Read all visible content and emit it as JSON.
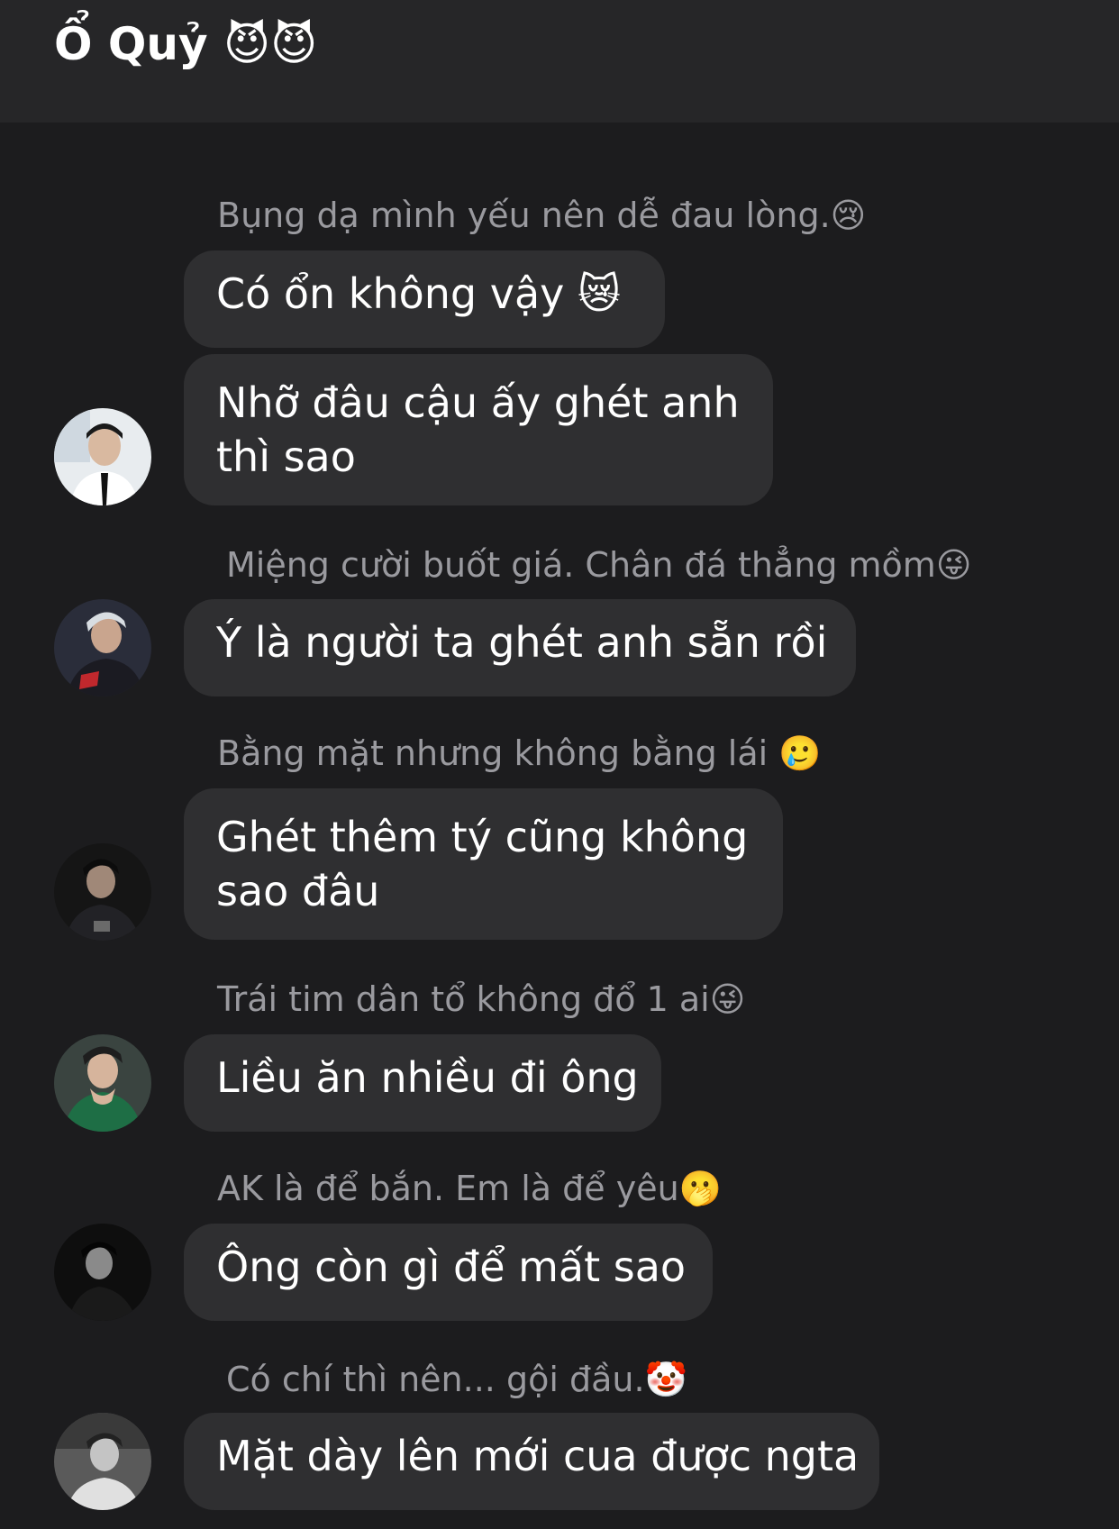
{
  "header": {
    "title": "Ổ Quỷ 😈😈"
  },
  "messages": [
    {
      "nickname": "Bụng dạ mình yếu nên dễ đau lòng.😢",
      "bubbles": [
        "Có ổn không vậy 😿",
        "Nhỡ đâu cậu ấy ghét anh thì sao"
      ],
      "avatar_icon": "avatar-white-shirt-tie"
    },
    {
      "nickname": "Miệng cười buốt giá. Chân đá thẳng mồm😜",
      "bubbles": [
        "Ý là người ta ghét anh sẵn rồi"
      ],
      "avatar_icon": "avatar-silver-hair-jersey"
    },
    {
      "nickname": "Bằng mặt nhưng không bằng lái 🥲",
      "bubbles": [
        "Ghét thêm tý cũng không sao đâu"
      ],
      "avatar_icon": "avatar-dark-jersey"
    },
    {
      "nickname": "Trái tim dân tổ không đổ 1 ai😜",
      "bubbles": [
        "Liều ăn nhiều đi ông"
      ],
      "avatar_icon": "avatar-green-jersey"
    },
    {
      "nickname": "AK là để bắn. Em là để yêu🫢",
      "bubbles": [
        "Ông còn gì để mất sao"
      ],
      "avatar_icon": "avatar-dark-portrait"
    },
    {
      "nickname": "Có chí thì nên... gội đầu.🤡",
      "bubbles": [
        "Mặt dày lên mới cua được ngta"
      ],
      "avatar_icon": "avatar-bw-portrait"
    }
  ],
  "colors": {
    "background": "#1c1c1e",
    "header": "#262628",
    "bubble": "#2f2f31",
    "nickname": "#9a9a9f",
    "text": "#ffffff"
  }
}
